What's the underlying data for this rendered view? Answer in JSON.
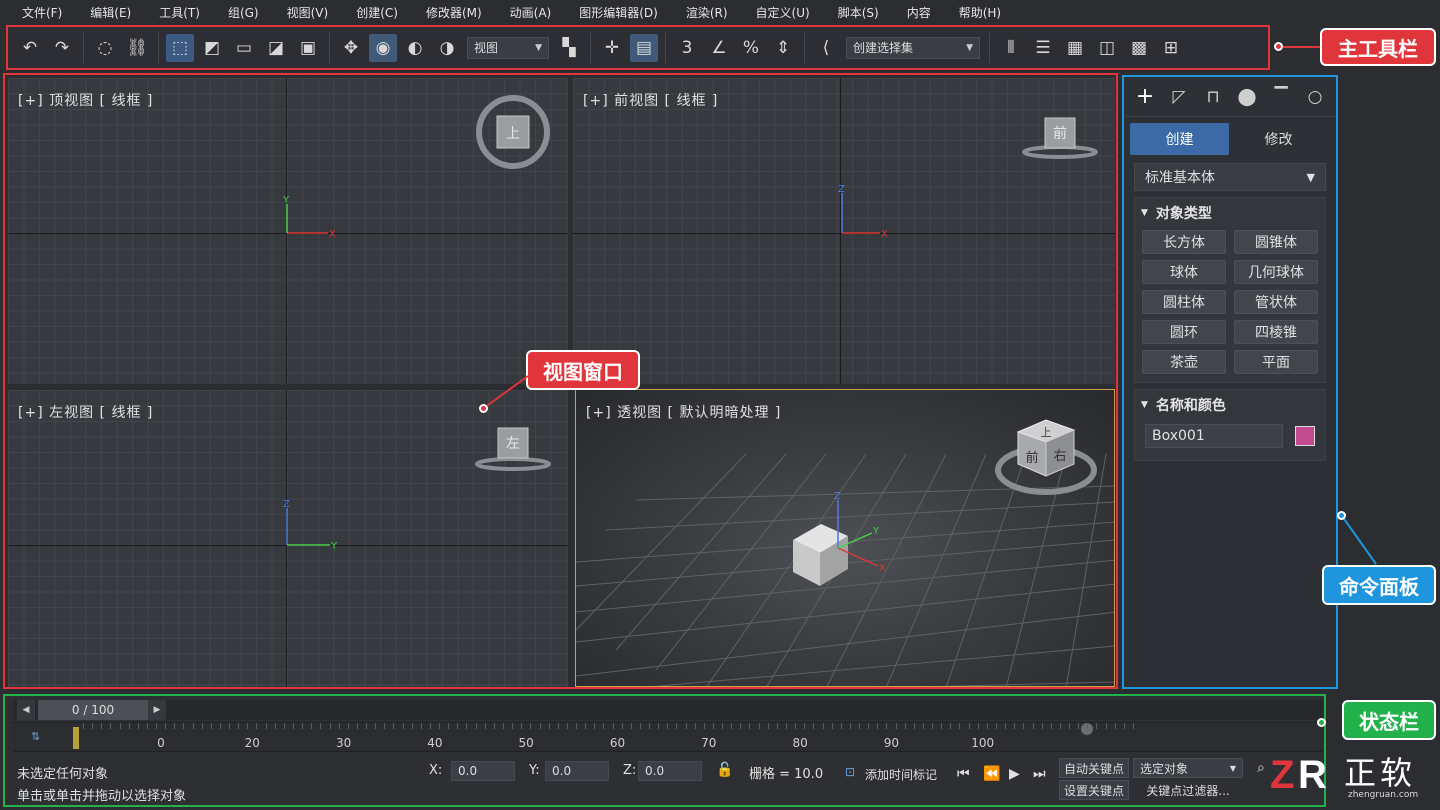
{
  "menu": [
    "文件(F)",
    "编辑(E)",
    "工具(T)",
    "组(G)",
    "视图(V)",
    "创建(C)",
    "修改器(M)",
    "动画(A)",
    "图形编辑器(D)",
    "渲染(R)",
    "自定义(U)",
    "脚本(S)",
    "内容",
    "帮助(H)"
  ],
  "toolbar": {
    "view_dropdown": "视图",
    "selset_dropdown": "创建选择集"
  },
  "viewports": {
    "top": {
      "label": "[+] 顶视图 [ 线框 ]",
      "cube": "上",
      "ax1": "X",
      "ax2": "Y"
    },
    "front": {
      "label": "[+] 前视图 [ 线框 ]",
      "cube": "前",
      "ax1": "X",
      "ax2": "Z"
    },
    "left": {
      "label": "[+] 左视图 [ 线框 ]",
      "cube": "左",
      "ax1": "Y",
      "ax2": "Z"
    },
    "persp": {
      "label": "[+] 透视图 [ 默认明暗处理 ]",
      "cube_top": "上",
      "cube_front": "前",
      "cube_right": "右",
      "ax_x": "X",
      "ax_y": "Y",
      "ax_z": "Z"
    }
  },
  "command_panel": {
    "tabs": [
      "创建",
      "修改"
    ],
    "category": "标准基本体",
    "object_type_title": "对象类型",
    "object_types": [
      "长方体",
      "圆锥体",
      "球体",
      "几何球体",
      "圆柱体",
      "管状体",
      "圆环",
      "四棱锥",
      "茶壶",
      "平面"
    ],
    "name_color_title": "名称和颜色",
    "object_name": "Box001",
    "object_color": "#c24a8f"
  },
  "timeline": {
    "frame": "0 / 100",
    "ticks": [
      "0",
      "20",
      "30",
      "40",
      "50",
      "60",
      "70",
      "80",
      "90",
      "100"
    ]
  },
  "status": {
    "selection": "未选定任何对象",
    "prompt": "单击或单击并拖动以选择对象",
    "x_label": "X:",
    "x_value": "0.0",
    "y_label": "Y:",
    "y_value": "0.0",
    "z_label": "Z:",
    "z_value": "0.0",
    "grid": "栅格 = 10.0",
    "add_time_tag": "添加时间标记",
    "auto_key": "自动关键点",
    "set_key": "设置关键点",
    "selected_dd": "选定对象",
    "key_filter": "关键点过滤器..."
  },
  "callouts": {
    "main_toolbar": "主工具栏",
    "viewport": "视图窗口",
    "command_panel": "命令面板",
    "status_bar": "状态栏"
  },
  "watermark": {
    "brand": "正软",
    "url": "zhengruan.com"
  }
}
